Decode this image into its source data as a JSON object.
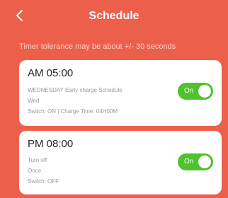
{
  "header": {
    "title": "Schedule"
  },
  "notice": "Timer tolerance may be about +/- 30 seconds",
  "schedules": [
    {
      "time": "AM 05:00",
      "name": "WEDNESDAY Early charge Schedule",
      "repeat": "Wed",
      "detail": "Switch: ON | Charge Time: 04H00M",
      "toggle_label": "On",
      "enabled": true
    },
    {
      "time": "PM 08:00",
      "name": "Turn off",
      "repeat": "Once",
      "detail": "Switch: OFF",
      "toggle_label": "On",
      "enabled": true
    }
  ],
  "colors": {
    "background": "#ec5f4a",
    "toggle_on": "#4fc22e",
    "card": "#ffffff"
  }
}
